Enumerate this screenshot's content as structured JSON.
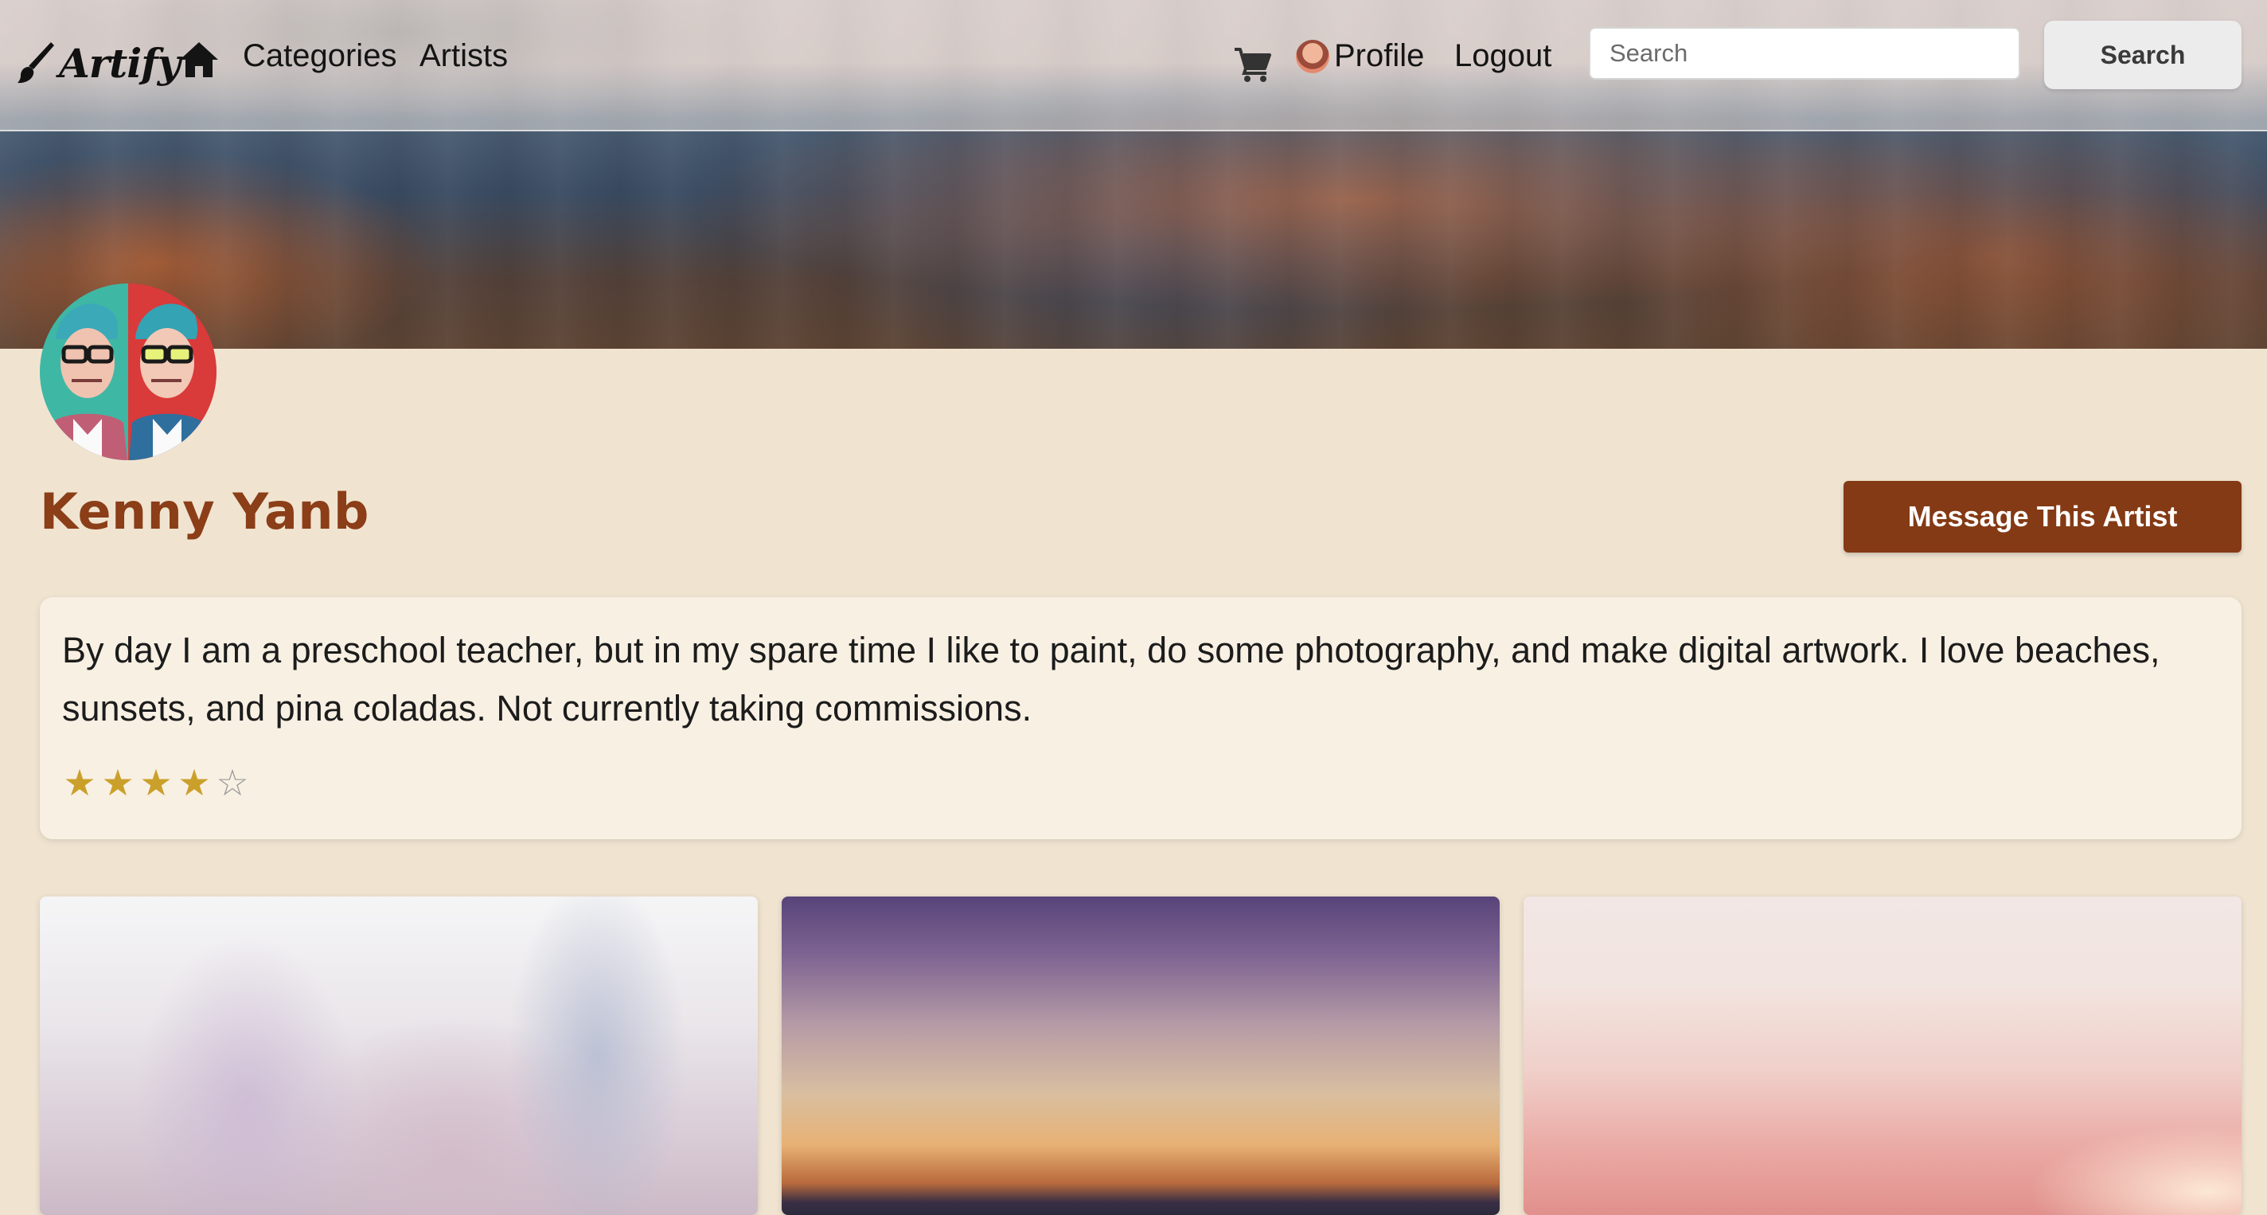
{
  "nav": {
    "logo_text": "Artify",
    "categories_label": "Categories",
    "artists_label": "Artists",
    "profile_label": "Profile",
    "logout_label": "Logout",
    "search_placeholder": "Search",
    "search_button_label": "Search"
  },
  "artist": {
    "name": "Kenny Yanb",
    "message_button_label": "Message This Artist",
    "bio": "By day I am a preschool teacher, but in my spare time I like to paint, do some photography, and make digital artwork. I love beaches, sunsets, and pina coladas. Not currently taking commissions.",
    "rating": 4,
    "rating_max": 5
  },
  "colors": {
    "page_background": "#f0e4d1",
    "accent": "#843a15",
    "artist_name": "#8b3e17",
    "star": "#caa02b"
  },
  "icons": [
    "paintbrush-icon",
    "home-icon",
    "cart-icon"
  ]
}
